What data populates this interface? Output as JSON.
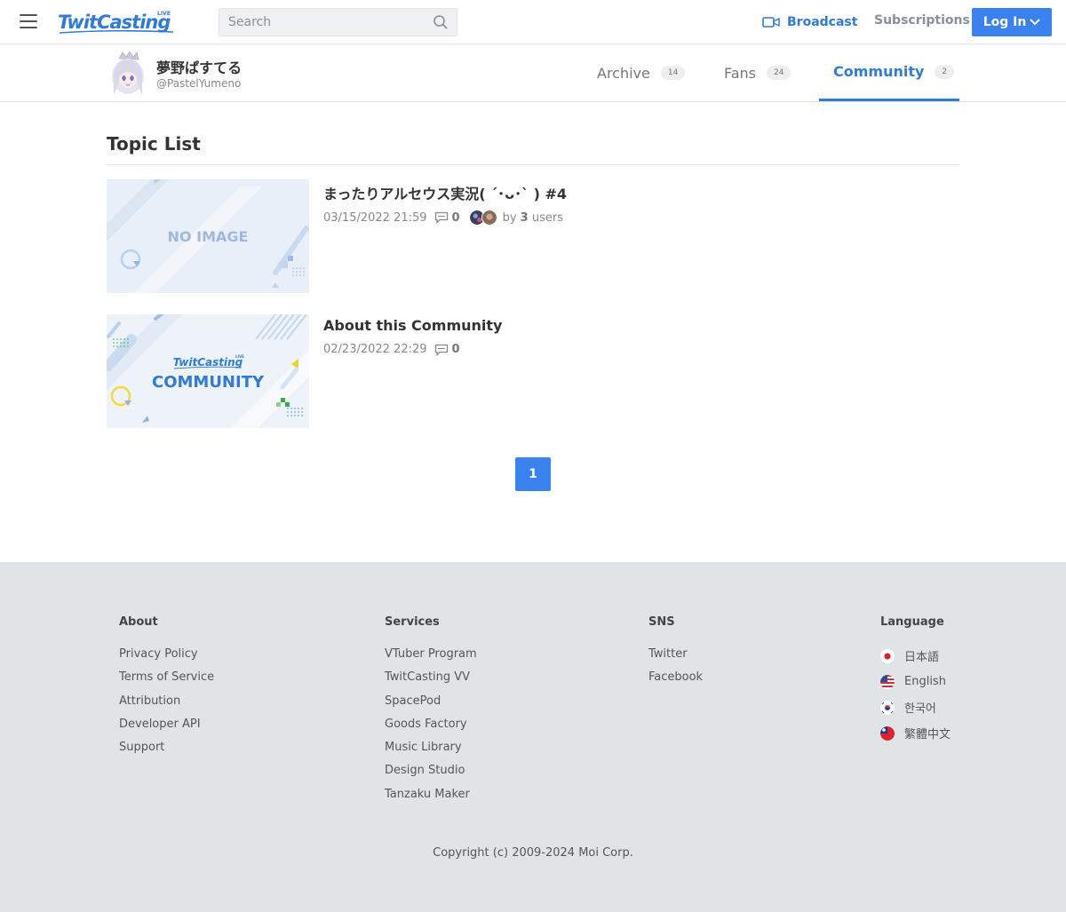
{
  "nav": {
    "logo_text": "TwitCasting",
    "logo_badge": "LIVE",
    "search_placeholder": "Search",
    "broadcast_label": "Broadcast",
    "subscriptions_label": "Subscriptions",
    "login_label": "Log In"
  },
  "profile": {
    "name": "夢野ぱすてる",
    "handle": "@PastelYumeno",
    "tabs": [
      {
        "label": "Archive",
        "count": "14"
      },
      {
        "label": "Fans",
        "count": "24"
      },
      {
        "label": "Community",
        "count": "2",
        "active": true
      }
    ]
  },
  "main": {
    "heading": "Topic List",
    "topics": [
      {
        "title": "まったりアルセウス実況( ´･ᴗ･` ) #4",
        "date": "03/15/2022 21:59",
        "comments": "0",
        "by_prefix": "by",
        "users_count": "3",
        "users_suffix": "users",
        "thumb_text": "NO IMAGE"
      },
      {
        "title": "About this Community",
        "date": "02/23/2022 22:29",
        "comments": "0",
        "thumb_brand": "TwitCasting",
        "thumb_badge": "LIVE",
        "thumb_text": "COMMUNITY"
      }
    ],
    "pagination": {
      "current": "1"
    }
  },
  "footer": {
    "about": {
      "heading": "About",
      "links": [
        "Privacy Policy",
        "Terms of Service",
        "Attribution",
        "Developer API",
        "Support"
      ]
    },
    "services": {
      "heading": "Services",
      "links": [
        "VTuber Program",
        "TwitCasting VV",
        "SpacePod",
        "Goods Factory",
        "Music Library",
        "Design Studio",
        "Tanzaku Maker"
      ]
    },
    "sns": {
      "heading": "SNS",
      "links": [
        "Twitter",
        "Facebook"
      ]
    },
    "language": {
      "heading": "Language",
      "options": [
        {
          "label": "日本語",
          "flag": "japan-flag-icon"
        },
        {
          "label": "English",
          "flag": "usa-flag-icon"
        },
        {
          "label": "한국어",
          "flag": "korea-flag-icon"
        },
        {
          "label": "繁體中文",
          "flag": "taiwan-flag-icon"
        }
      ]
    },
    "copyright": "Copyright (c) 2009-2024 Moi Corp."
  },
  "colors": {
    "accent": "#3a82f0",
    "link_blue": "#2f7bd6",
    "footer_bg": "#e1e4e7"
  }
}
